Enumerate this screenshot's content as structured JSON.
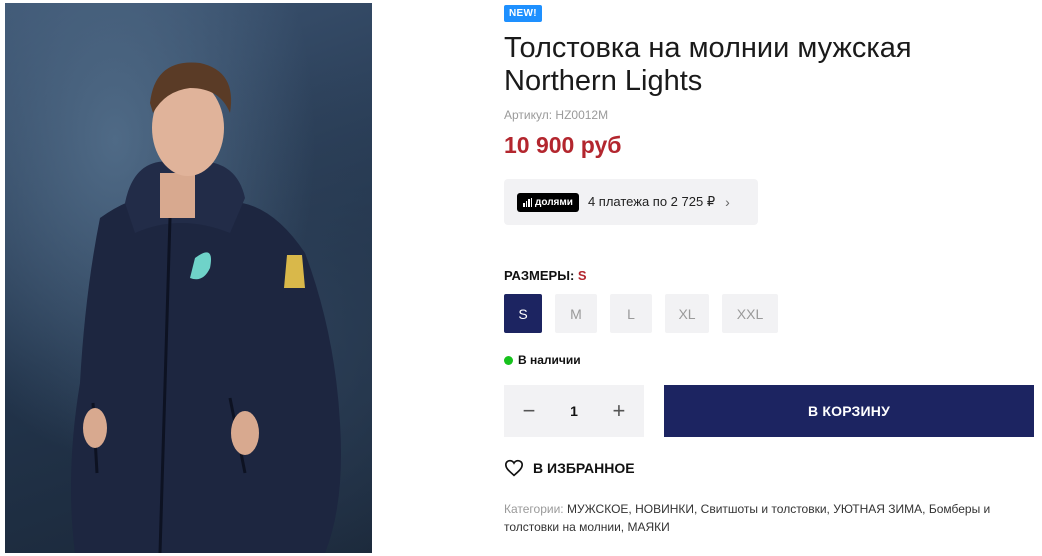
{
  "image": {
    "alt": "man in navy zip hoodie"
  },
  "badge": "NEW!",
  "title_line1": "Толстовка на молнии мужская",
  "title_line2": "Northern Lights",
  "sku": "Артикул: HZ0012M",
  "price": "10 900 руб",
  "split": {
    "logo": "долями",
    "text": "4 платежа по 2 725 ₽",
    "chevron": "›"
  },
  "sizes": {
    "label": "РАЗМЕРЫ: ",
    "selected": "S",
    "options": [
      "S",
      "M",
      "L",
      "XL",
      "XXL"
    ]
  },
  "stock": "В наличии",
  "qty": {
    "minus": "−",
    "value": "1",
    "plus": "+"
  },
  "cart_button": "В КОРЗИНУ",
  "favorite": "В ИЗБРАННОЕ",
  "categories": {
    "label": "Категории: ",
    "list": "МУЖСКОЕ, НОВИНКИ, Свитшоты и толстовки, УЮТНАЯ ЗИМА, Бомберы и толстовки на молнии, МАЯКИ"
  },
  "colors": {
    "accent": "#1c2461",
    "price": "#b3262e",
    "badge": "#1e90ff",
    "stock": "#17c21d"
  }
}
